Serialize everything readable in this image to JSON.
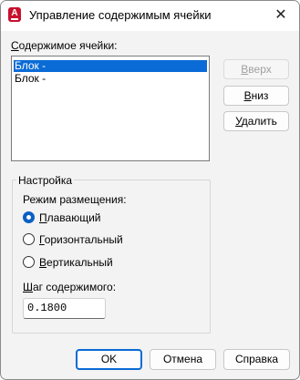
{
  "window": {
    "title": "Управление содержимым ячейки"
  },
  "cell_content": {
    "label_underline": "С",
    "label_rest": "одержимое ячейки:",
    "items": [
      "Блок -",
      "Блок -"
    ],
    "selected_index": 0
  },
  "side_buttons": {
    "up": {
      "underline": "В",
      "rest": "верх"
    },
    "down": {
      "underline": "В",
      "rest": "низ"
    },
    "delete": {
      "underline": "У",
      "rest": "далить"
    }
  },
  "settings": {
    "group_title": "Настройка",
    "placement_label": "Режим размещения:",
    "radio_floating": {
      "underline": "П",
      "rest": "лавающий",
      "checked": true
    },
    "radio_horizontal": {
      "underline": "Г",
      "rest": "оризонтальный",
      "checked": false
    },
    "radio_vertical": {
      "underline": "В",
      "rest": "ертикальный",
      "checked": false
    },
    "spacing_label_underline": "Ш",
    "spacing_label_rest": "аг содержимого:",
    "spacing_value": "0.1800"
  },
  "footer": {
    "ok": "OK",
    "cancel": "Отмена",
    "help": "Справка"
  },
  "colors": {
    "accent": "#0a6bd6",
    "selection": "#0a6bd6",
    "app_icon": "#c8102e"
  },
  "icons": {
    "app": "autocad-icon",
    "close": "close-icon"
  }
}
